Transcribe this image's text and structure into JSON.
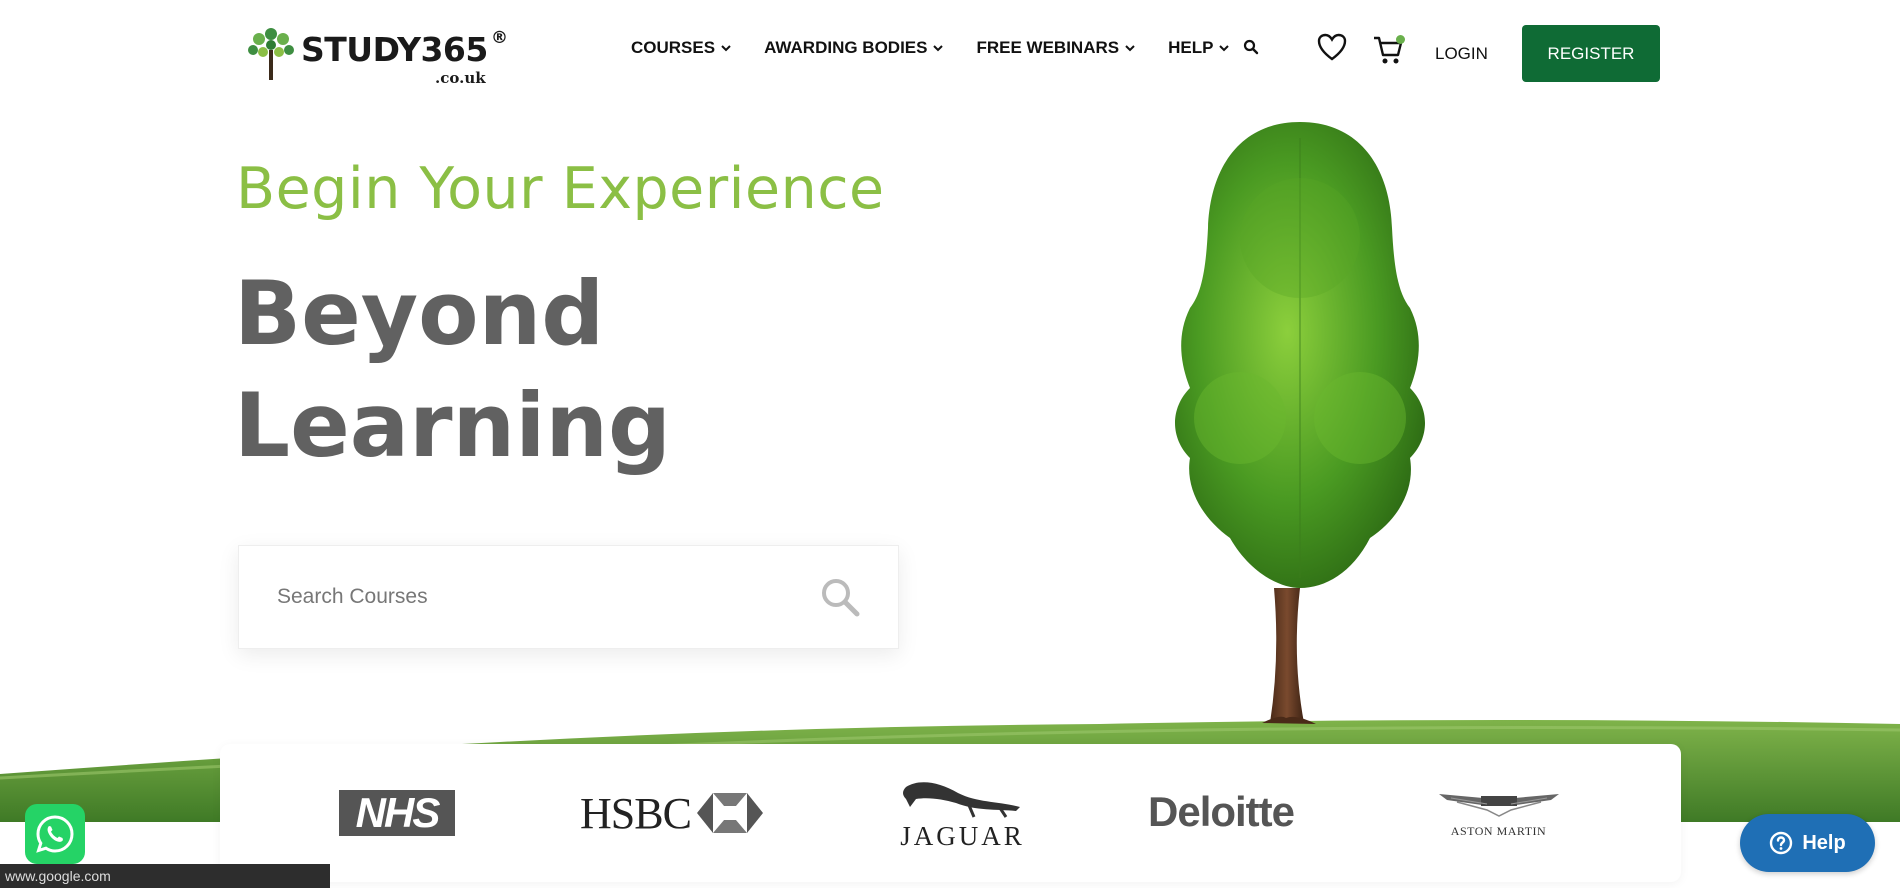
{
  "header": {
    "logo_text": "STUDY365",
    "logo_reg": "®",
    "logo_sub": ".co.uk",
    "nav": [
      {
        "label": "COURSES"
      },
      {
        "label": "AWARDING BODIES"
      },
      {
        "label": "FREE WEBINARS"
      },
      {
        "label": "HELP"
      }
    ],
    "login_label": "LOGIN",
    "register_label": "REGISTER",
    "icons": [
      "search-icon",
      "heart-icon",
      "cart-icon"
    ]
  },
  "hero": {
    "subtitle": "Begin Your Experience",
    "title_line1": "Beyond",
    "title_line2": "Learning",
    "search_placeholder": "Search Courses"
  },
  "partners": {
    "items": [
      "NHS",
      "HSBC",
      "JAGUAR",
      "Deloitte",
      "ASTON MARTIN"
    ]
  },
  "widgets": {
    "help_label": "Help",
    "status_url": "www.google.com"
  },
  "colors": {
    "brand_green": "#0f6b35",
    "accent_green": "#8bbf45",
    "heading_gray": "#616161",
    "help_blue": "#1f6fb5",
    "whatsapp_green": "#25d366"
  }
}
